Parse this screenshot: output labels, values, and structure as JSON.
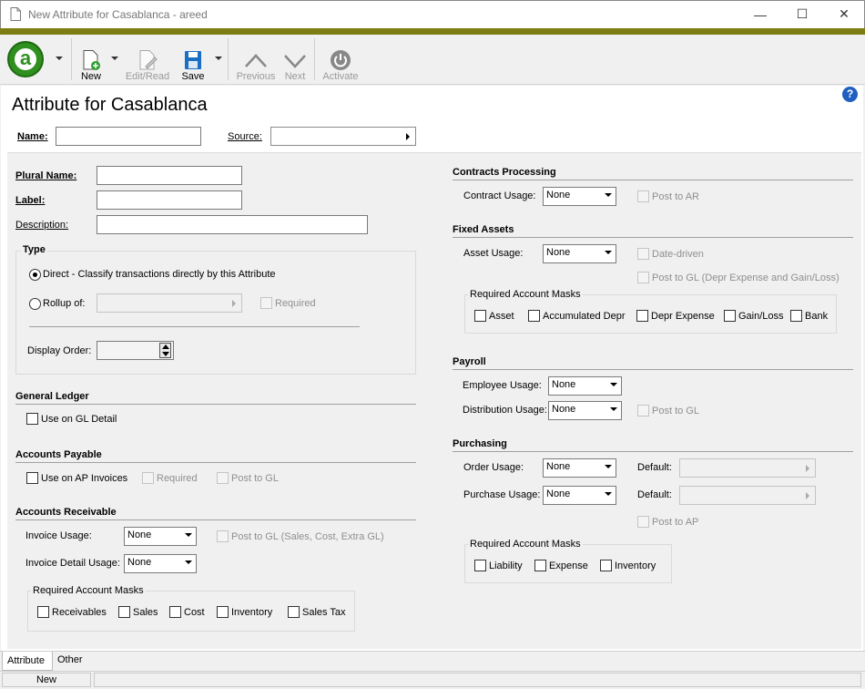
{
  "window": {
    "title": "New Attribute for Casablanca - areed"
  },
  "toolbar": {
    "new": "New",
    "edit_read": "Edit/Read",
    "save": "Save",
    "previous": "Previous",
    "next": "Next",
    "activate": "Activate"
  },
  "header": {
    "title": "Attribute for Casablanca",
    "name_label": "Name:",
    "name_value": "",
    "source_label": "Source:",
    "source_value": ""
  },
  "left": {
    "plural_name_label": "Plural Name:",
    "plural_name_value": "",
    "label_label": "Label:",
    "label_value": "",
    "description_label": "Description:",
    "description_value": "",
    "type": {
      "title": "Type",
      "direct_label": "Direct - Classify transactions directly by this Attribute",
      "rollup_label": "Rollup of:",
      "required_label": "Required",
      "display_order_label": "Display Order:",
      "display_order_value": ""
    },
    "general_ledger": {
      "title": "General Ledger",
      "use_on_gl_detail": "Use on GL Detail"
    },
    "accounts_payable": {
      "title": "Accounts Payable",
      "use_on_ap_invoices": "Use on AP Invoices",
      "required": "Required",
      "post_to_gl": "Post to GL"
    },
    "accounts_receivable": {
      "title": "Accounts Receivable",
      "invoice_usage_label": "Invoice Usage:",
      "invoice_usage_value": "None",
      "post_to_gl": "Post to GL (Sales, Cost, Extra GL)",
      "invoice_detail_usage_label": "Invoice Detail Usage:",
      "invoice_detail_usage_value": "None",
      "masks_title": "Required Account Masks",
      "masks": [
        "Receivables",
        "Sales",
        "Cost",
        "Inventory",
        "Sales Tax"
      ]
    }
  },
  "right": {
    "contracts": {
      "title": "Contracts Processing",
      "usage_label": "Contract Usage:",
      "usage_value": "None",
      "post_to_ar": "Post to AR"
    },
    "fixed_assets": {
      "title": "Fixed Assets",
      "usage_label": "Asset Usage:",
      "usage_value": "None",
      "date_driven": "Date-driven",
      "post_to_gl": "Post to GL (Depr Expense and Gain/Loss)",
      "masks_title": "Required Account Masks",
      "masks": [
        "Asset",
        "Accumulated Depr",
        "Depr Expense",
        "Gain/Loss",
        "Bank"
      ]
    },
    "payroll": {
      "title": "Payroll",
      "employee_usage_label": "Employee Usage:",
      "employee_usage_value": "None",
      "distribution_usage_label": "Distribution Usage:",
      "distribution_usage_value": "None",
      "post_to_gl": "Post to GL"
    },
    "purchasing": {
      "title": "Purchasing",
      "order_usage_label": "Order Usage:",
      "order_usage_value": "None",
      "default_label": "Default:",
      "purchase_usage_label": "Purchase Usage:",
      "purchase_usage_value": "None",
      "default2_label": "Default:",
      "post_to_ap": "Post to AP",
      "masks_title": "Required Account Masks",
      "masks": [
        "Liability",
        "Expense",
        "Inventory"
      ]
    }
  },
  "tabs": [
    "Attribute",
    "Other"
  ],
  "status": {
    "mode": "New"
  },
  "colors": {
    "accent_bar": "#7e7d14",
    "logo_green": "#2f8f1f",
    "save_blue": "#1a6fc4",
    "help_blue": "#1f5fbf"
  }
}
